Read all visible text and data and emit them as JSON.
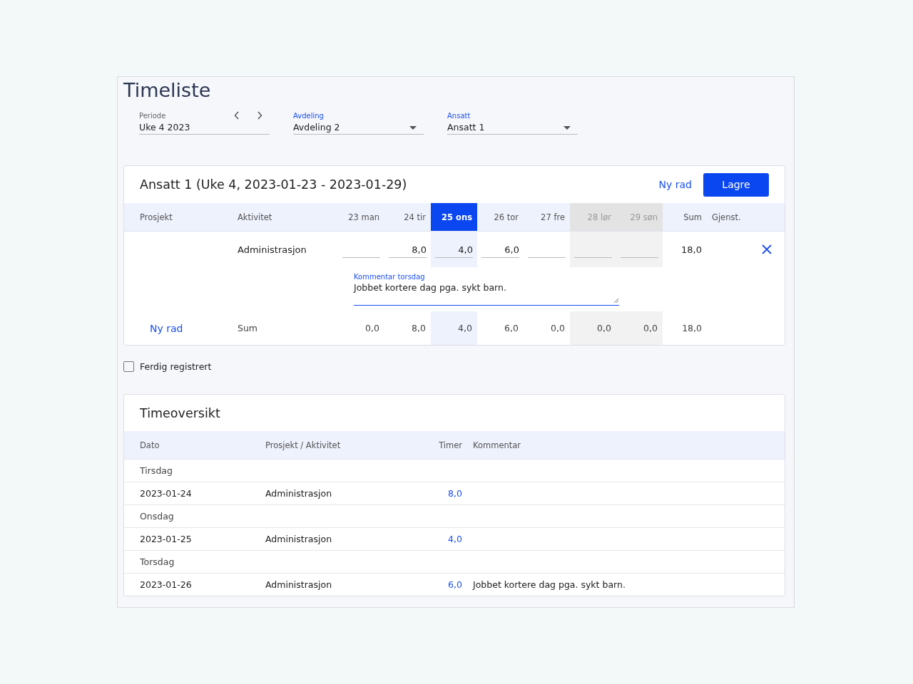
{
  "title": "Timeliste",
  "filters": [
    {
      "kind": "period",
      "label": "Periode",
      "value": "Uke 4 2023"
    },
    {
      "kind": "select",
      "label": "Avdeling",
      "value": "Avdeling 2"
    },
    {
      "kind": "select",
      "label": "Ansatt",
      "value": "Ansatt 1"
    }
  ],
  "timesheet": {
    "title": "Ansatt 1 (Uke 4, 2023-01-23 - 2023-01-29)",
    "new_row_link": "Ny rad",
    "save_button": "Lagre",
    "columns": {
      "project": "Prosjekt",
      "activity": "Aktivitet",
      "sum": "Sum",
      "remaining": "Gjenst."
    },
    "days": [
      {
        "label": "23 man",
        "weekend": false,
        "selected": false
      },
      {
        "label": "24 tir",
        "weekend": false,
        "selected": false
      },
      {
        "label": "25 ons",
        "weekend": false,
        "selected": true
      },
      {
        "label": "26 tor",
        "weekend": false,
        "selected": false
      },
      {
        "label": "27 fre",
        "weekend": false,
        "selected": false
      },
      {
        "label": "28 lør",
        "weekend": true,
        "selected": false
      },
      {
        "label": "29 søn",
        "weekend": true,
        "selected": false
      }
    ],
    "rows": [
      {
        "activity": "Administrasjon",
        "hours": {
          "1": "8,0",
          "2": "4,0",
          "3": "6,0"
        },
        "sum": "18,0",
        "comment": {
          "label": "Kommentar torsdag",
          "value": "Jobbet kortere dag pga. sykt barn."
        }
      }
    ],
    "footer": {
      "new_row_link": "Ny rad",
      "label": "Sum",
      "totals": [
        "0,0",
        "8,0",
        "4,0",
        "6,0",
        "0,0",
        "0,0",
        "0,0"
      ],
      "sum": "18,0"
    }
  },
  "done_checkbox": {
    "label": "Ferdig registrert",
    "checked": false
  },
  "overview": {
    "title": "Timeoversikt",
    "columns": [
      "Dato",
      "Prosjekt / Aktivitet",
      "Timer",
      "Kommentar"
    ],
    "groups": [
      {
        "label": "Tirsdag",
        "entries": [
          {
            "date": "2023-01-24",
            "activity": "Administrasjon",
            "hours": "8,0"
          }
        ]
      },
      {
        "label": "Onsdag",
        "entries": [
          {
            "date": "2023-01-25",
            "activity": "Administrasjon",
            "hours": "4,0"
          }
        ]
      },
      {
        "label": "Torsdag",
        "entries": [
          {
            "date": "2023-01-26",
            "activity": "Administrasjon",
            "hours": "6,0",
            "comment": "Jobbet kortere dag pga. sykt barn."
          }
        ]
      }
    ]
  }
}
